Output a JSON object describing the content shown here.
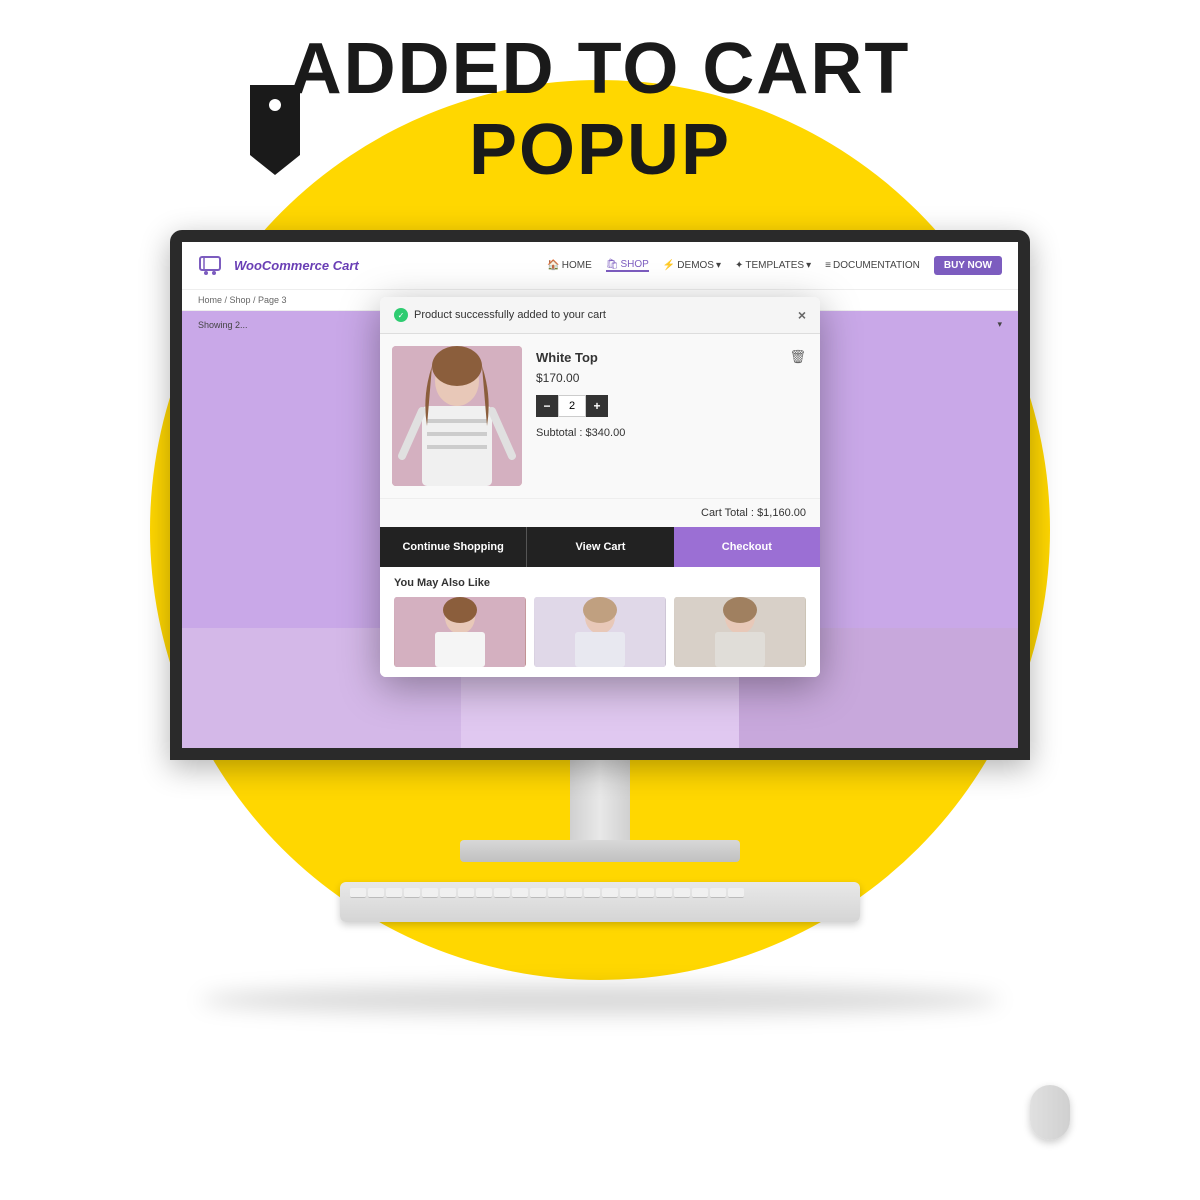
{
  "page": {
    "background_color": "#FFD700",
    "title_line1": "ADDED TO CART",
    "title_line2": "POPUP"
  },
  "website": {
    "logo_text": "WooCommerce Cart",
    "nav": {
      "items": [
        {
          "label": "HOME",
          "active": false
        },
        {
          "label": "SHOP",
          "active": true
        },
        {
          "label": "DEMOS",
          "active": false,
          "has_dropdown": true
        },
        {
          "label": "TEMPLATES",
          "active": false,
          "has_dropdown": true
        },
        {
          "label": "DOCUMENTATION",
          "active": false
        }
      ],
      "buy_button": "BUY NOW"
    },
    "breadcrumb": "Home / Shop / Page 3",
    "results_text": "Showing 2..."
  },
  "popup": {
    "success_message": "Product successfully added to your cart",
    "close_button_label": "×",
    "product": {
      "name": "White Top",
      "price": "$170.00",
      "quantity": "2",
      "subtotal_label": "Subtotal :",
      "subtotal_value": "$340.00",
      "cart_total_label": "Cart Total :",
      "cart_total_value": "$1,160.00"
    },
    "buttons": {
      "continue_shopping": "Continue Shopping",
      "view_cart": "View Cart",
      "checkout": "Checkout"
    },
    "also_like_title": "You May Also Like"
  }
}
